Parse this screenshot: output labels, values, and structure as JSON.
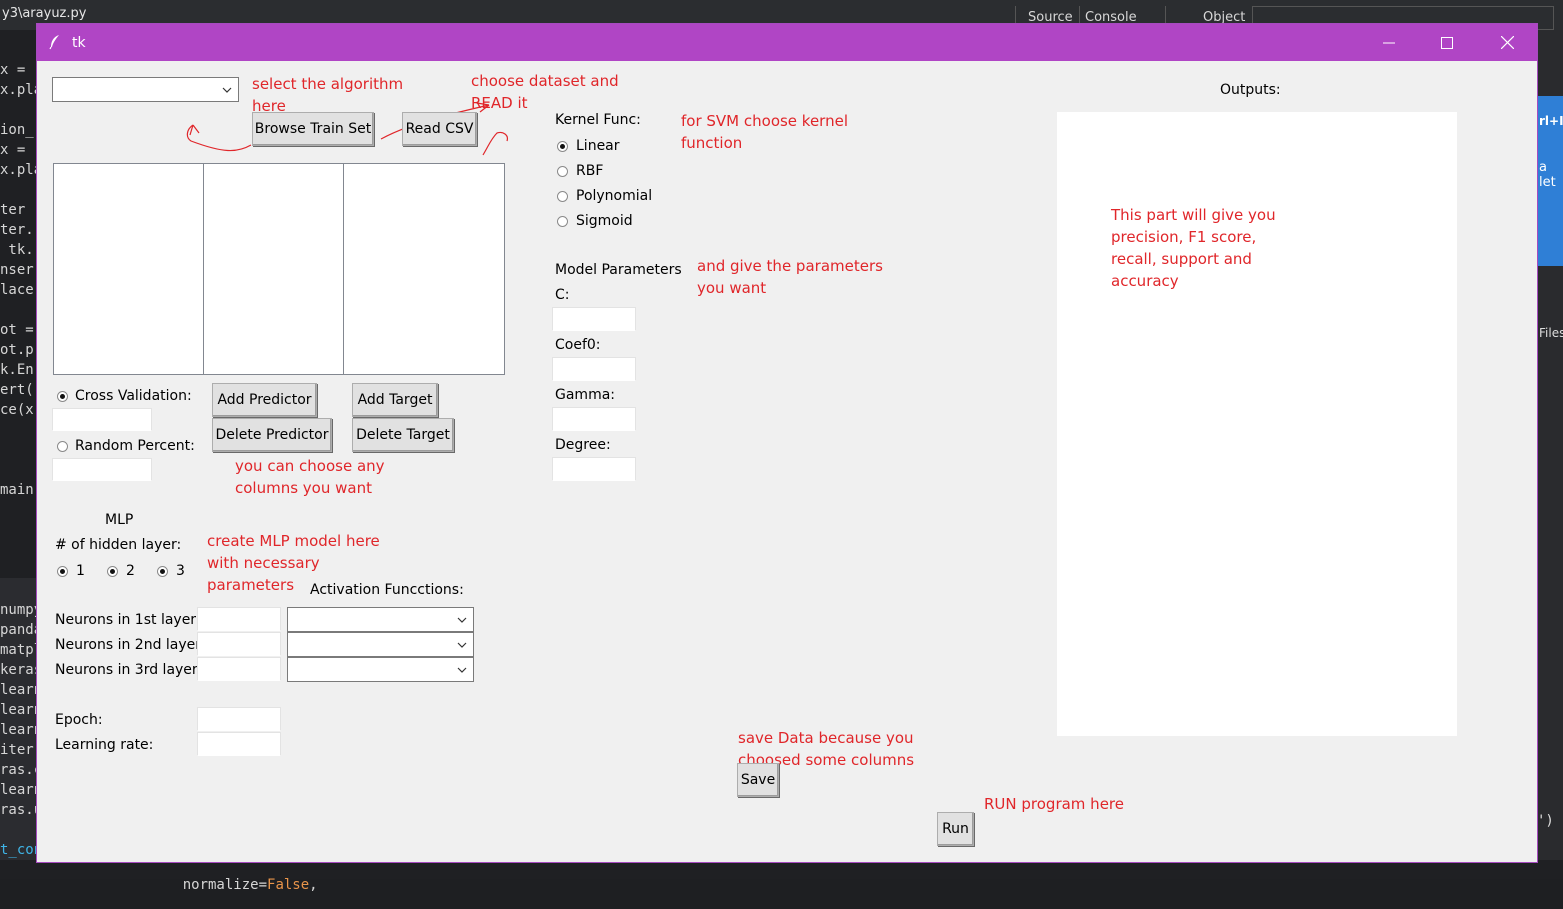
{
  "ide": {
    "path": "y3\\arayuz.py",
    "tabs": [
      "Source",
      "Console",
      "Object"
    ],
    "code_left_top": [
      "x = ",
      "x.pla",
      "",
      "ion_",
      "x = ",
      "x.pla",
      "",
      "ter ",
      "ter.",
      " tk.",
      "nser",
      "lace",
      "",
      "ot =",
      "ot.p",
      "k.En",
      "ert(",
      "ce(x",
      "",
      "",
      "",
      "main"
    ],
    "code_left_bottom": [
      "numpy",
      "panda",
      "matpl",
      "keras",
      "learn",
      "learn",
      "learn",
      "iter",
      "ras.c",
      "learn",
      "ras.u",
      "",
      "t_con"
    ],
    "bottom_line_prefix": "normalize=",
    "bottom_line_value": "False",
    "bottom_line_suffix": ",",
    "right_snippets": [
      "rl+I",
      "a let",
      "Files",
      "')"
    ]
  },
  "window": {
    "title": "tk",
    "minimize": "—",
    "maximize": "☐",
    "close": "✕"
  },
  "algorithm": {
    "selected": ""
  },
  "notes": {
    "algorithm": "select the algorithm\nhere",
    "dataset": "choose dataset and\nREAD it",
    "kernel": "for SVM choose kernel\nfunction",
    "params": "and give the parameters\nyou want",
    "outputs": "This part will give you\nprecision, F1 score,\nrecall, support and\naccuracy",
    "columns": "you can choose any\ncolumns you want",
    "mlp": "create MLP model here\nwith necessary\nparameters",
    "save": "save Data because you\nchoosed some columns",
    "run": "RUN program here"
  },
  "buttons": {
    "browse": "Browse Train Set",
    "read_csv": "Read CSV",
    "add_predictor": "Add Predictor",
    "delete_predictor": "Delete Predictor",
    "add_target": "Add Target",
    "delete_target": "Delete Target",
    "save": "Save",
    "run": "Run"
  },
  "split": {
    "cross_validation": "Cross Validation:",
    "random_percent": "Random Percent:",
    "cross_validation_selected": true
  },
  "kernel": {
    "label": "Kernel Func:",
    "options": [
      "Linear",
      "RBF",
      "Polynomial",
      "Sigmoid"
    ],
    "selected": "Linear"
  },
  "model_params": {
    "label": "Model Parameters",
    "c": "C:",
    "coef0": "Coef0:",
    "gamma": "Gamma:",
    "degree": "Degree:"
  },
  "mlp": {
    "title": "MLP",
    "hidden_label": "# of hidden layer:",
    "hidden_options": [
      "1",
      "2",
      "3"
    ],
    "activation_label": "Activation Funcctions:",
    "n1": "Neurons in 1st layer:",
    "n2": "Neurons in 2nd layer:",
    "n3": "Neurons in 3rd layer:",
    "epoch": "Epoch:",
    "lr": "Learning rate:"
  },
  "outputs": {
    "label": "Outputs:"
  }
}
